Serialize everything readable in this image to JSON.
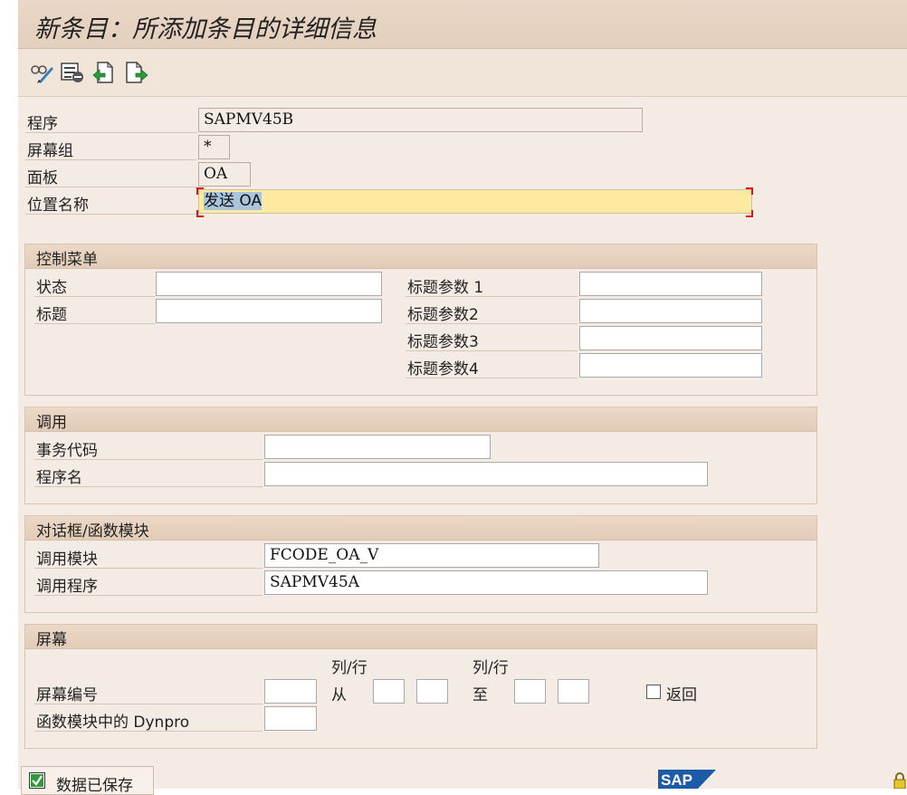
{
  "window": {
    "title": "新条目：所添加条目的详细信息"
  },
  "toolbar": {
    "icons": [
      "display-change-icon",
      "delete-entry-icon",
      "previous-entry-icon",
      "next-entry-icon"
    ]
  },
  "header_fields": {
    "program": {
      "label": "程序",
      "value": "SAPMV45B"
    },
    "screen_group": {
      "label": "屏幕组",
      "value": "*"
    },
    "panel": {
      "label": "面板",
      "value": "OA"
    },
    "position_name": {
      "label": "位置名称",
      "value": "发送 OA"
    }
  },
  "control_menu": {
    "title": "控制菜单",
    "status": {
      "label": "状态",
      "value": ""
    },
    "heading": {
      "label": "标题",
      "value": ""
    },
    "title_param1": {
      "label": "标题参数 1",
      "value": ""
    },
    "title_param2": {
      "label": "标题参数2",
      "value": ""
    },
    "title_param3": {
      "label": "标题参数3",
      "value": ""
    },
    "title_param4": {
      "label": "标题参数4",
      "value": ""
    }
  },
  "call": {
    "title": "调用",
    "transaction_code": {
      "label": "事务代码",
      "value": ""
    },
    "program_name": {
      "label": "程序名",
      "value": ""
    }
  },
  "dialog": {
    "title": "对话框/函数模块",
    "call_module": {
      "label": "调用模块",
      "value": "FCODE_OA_V"
    },
    "call_program": {
      "label": "调用程序",
      "value": "SAPMV45A"
    }
  },
  "screen": {
    "title": "屏幕",
    "col_row_label": "列/行",
    "col_row_label2": "列/行",
    "from_label": "从",
    "to_label": "至",
    "screen_number": {
      "label": "屏幕编号",
      "value": ""
    },
    "return_label": "返回",
    "dynpro": {
      "label": "函数模块中的 Dynpro",
      "value": ""
    }
  },
  "status_bar": {
    "message": "数据已保存",
    "logo": "SAP"
  },
  "colors": {
    "title_bg": "#e2cfbd",
    "panel_bg": "#f4ece4",
    "active_field": "#fde9a0",
    "selection": "#aac4dc",
    "focus_corner": "#d61515"
  }
}
